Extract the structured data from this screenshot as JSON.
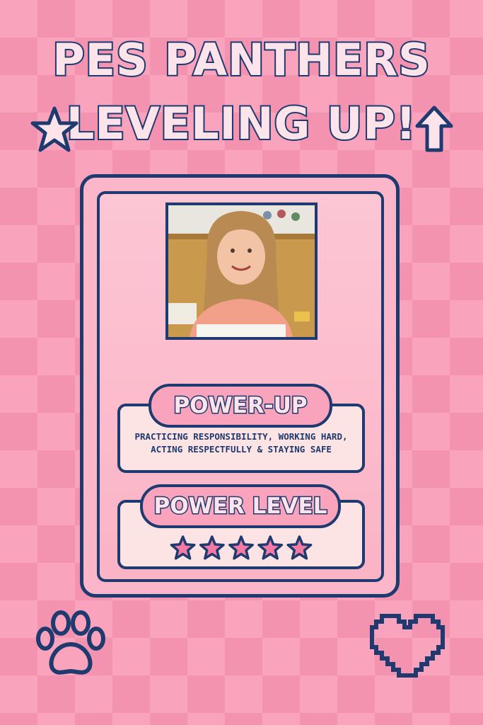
{
  "title": {
    "line1": "PES PANTHERS",
    "line2": "LEVELING UP!"
  },
  "icons": [
    "star-icon",
    "up-arrow-icon",
    "paw-print-icon",
    "heart-icon"
  ],
  "photo": {
    "subject": "student-photo"
  },
  "power_up": {
    "label": "POWER-UP",
    "description": "PRACTICING RESPONSIBILITY, WORKING HARD, ACTING RESPECTFULLY & STAYING SAFE"
  },
  "power_level": {
    "label": "POWER LEVEL",
    "stars": 5,
    "max_stars": 5
  },
  "colors": {
    "navy": "#1e3a6e",
    "pink": "#f9a3bd",
    "light_pink": "#fde4ea",
    "star_fill": "#f27aa4"
  }
}
